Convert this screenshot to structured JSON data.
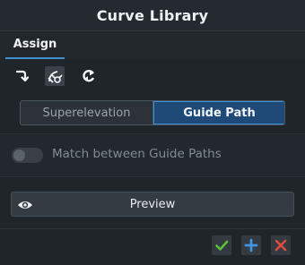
{
  "panel": {
    "title": "Curve Library"
  },
  "tabs": [
    {
      "label": "Assign",
      "active": true
    }
  ],
  "toolbar": {
    "tools": [
      {
        "icon": "curved-arrow-down-icon",
        "active": false
      },
      {
        "icon": "curve-wrench-icon",
        "active": true
      },
      {
        "icon": "cycle-arrows-icon",
        "active": false
      }
    ]
  },
  "mode_selector": {
    "options": [
      "Superelevation",
      "Guide Path"
    ],
    "selected": "Guide Path"
  },
  "options": {
    "match_guide_paths": {
      "label": "Match between Guide Paths",
      "enabled": false
    }
  },
  "preview": {
    "label": "Preview",
    "icon": "eye-icon"
  },
  "footer": {
    "buttons": [
      {
        "icon": "check-icon",
        "color": "#5fbf3a"
      },
      {
        "icon": "plus-icon",
        "color": "#3f95e0"
      },
      {
        "icon": "close-icon",
        "color": "#e04a3f"
      }
    ]
  },
  "colors": {
    "accent": "#3f8fd1",
    "selected_segment": "#1f4a78",
    "background": "#20252a"
  }
}
